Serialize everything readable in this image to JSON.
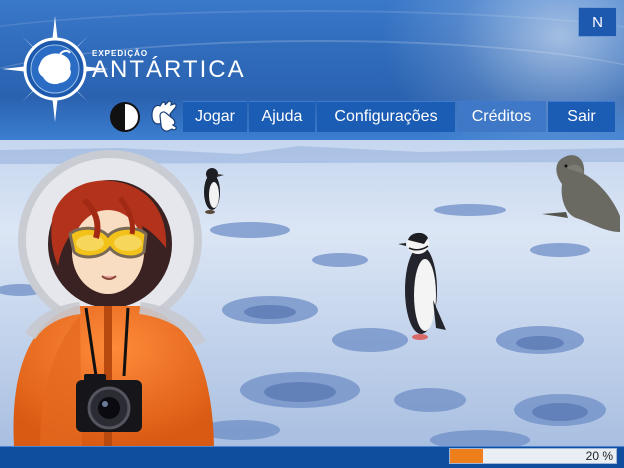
{
  "brand": {
    "subtitle": "EXPEDIÇÃO",
    "title": "ANTÁRTICA"
  },
  "top_button": {
    "label": "N"
  },
  "accessibility": {
    "contrast_icon": "contrast-icon",
    "sign_language_icon": "sign-language-icon"
  },
  "nav": {
    "items": [
      {
        "label": "Jogar"
      },
      {
        "label": "Ajuda"
      },
      {
        "label": "Configurações"
      },
      {
        "label": "Créditos"
      },
      {
        "label": "Sair"
      }
    ]
  },
  "progress": {
    "value": 0.2,
    "label": "20 %"
  },
  "colors": {
    "header_blue": "#2e69b8",
    "nav_blue": "#1b5cb4",
    "nav_active": "#3f78c6",
    "progress_orange": "#ee7d1c",
    "bottom_bar": "#0f4e9e"
  }
}
